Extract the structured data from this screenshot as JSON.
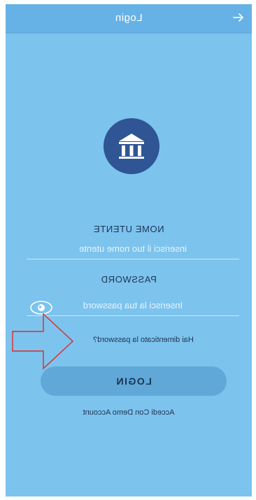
{
  "appbar": {
    "title": "Login",
    "back_icon": "arrow-right-icon"
  },
  "logo": {
    "icon": "bank-building-icon"
  },
  "username": {
    "label": "NOME UTENTE",
    "placeholder": "inserisci il tuo nome utente"
  },
  "password": {
    "label": "PASSWORD",
    "placeholder": "Inserisci la tua password",
    "visibility_icon": "eye-icon"
  },
  "forgot_link": "Hai dimenticato la password?",
  "login_button": "LOGIN",
  "demo_link": "Accedi Con Demo Account",
  "annotation": {
    "icon": "red-arrow-icon"
  },
  "colors": {
    "background": "#7cc3ee",
    "appbar": "#66b2e6",
    "logo_circle": "#2f5594",
    "button": "#5fa8d8",
    "annotation_arrow": "#e02a2a"
  }
}
